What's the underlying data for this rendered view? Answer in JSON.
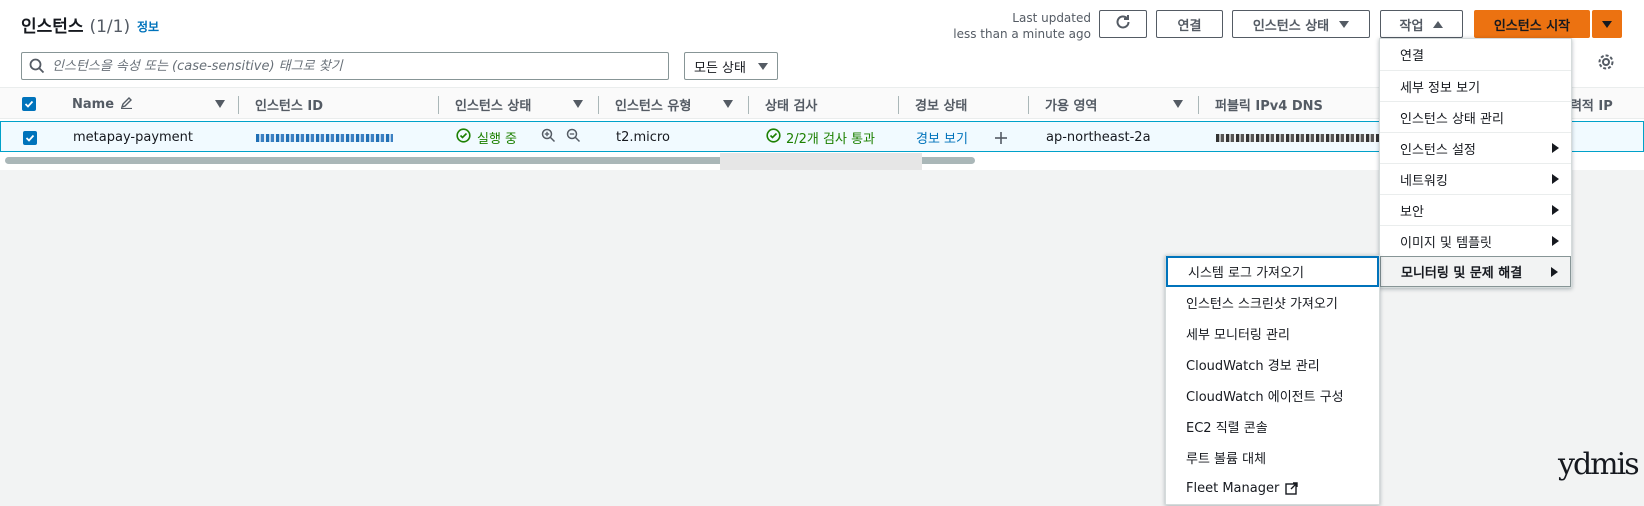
{
  "header": {
    "title": "인스턴스",
    "count": "(1/1)",
    "info_link": "정보",
    "last_updated_line1": "Last updated",
    "last_updated_line2": "less than a minute ago"
  },
  "toolbar": {
    "connect_label": "연결",
    "instance_state_label": "인스턴스 상태",
    "actions_label": "작업",
    "launch_label": "인스턴스 시작"
  },
  "filter": {
    "search_placeholder": "인스턴스을 속성 또는 (case-sensitive) 태그로 찾기",
    "state_select": "모든 상태"
  },
  "table": {
    "columns": [
      "Name",
      "인스턴스 ID",
      "인스턴스 상태",
      "인스턴스 유형",
      "상태 검사",
      "경보 상태",
      "가용 영역",
      "퍼블릭 IPv4 DNS",
      "탄력적 IP"
    ],
    "rows": [
      {
        "name": "metapay-payment",
        "state": "실행 중",
        "type": "t2.micro",
        "status_check": "2/2개 검사 통과",
        "alarm": "경보 보기",
        "az": "ap-northeast-2a"
      }
    ]
  },
  "actions_menu": {
    "items": [
      {
        "label": "연결",
        "submenu": false
      },
      {
        "label": "세부 정보 보기",
        "submenu": false
      },
      {
        "label": "인스턴스 상태 관리",
        "submenu": false
      },
      {
        "label": "인스턴스 설정",
        "submenu": true
      },
      {
        "label": "네트워킹",
        "submenu": true
      },
      {
        "label": "보안",
        "submenu": true
      },
      {
        "label": "이미지 및 템플릿",
        "submenu": true
      },
      {
        "label": "모니터링 및 문제 해결",
        "submenu": true
      }
    ]
  },
  "monitoring_submenu": {
    "items": [
      "시스템 로그 가져오기",
      "인스턴스 스크린샷 가져오기",
      "세부 모니터링 관리",
      "CloudWatch 경보 관리",
      "CloudWatch 에이전트 구성",
      "EC2 직렬 콘솔",
      "루트 볼륨 대체",
      "Fleet Manager"
    ]
  },
  "watermark": "ydmis",
  "colors": {
    "primary": "#ec7211",
    "link": "#0073bb",
    "success": "#1d8102",
    "selected_row_bg": "#f1faff"
  }
}
